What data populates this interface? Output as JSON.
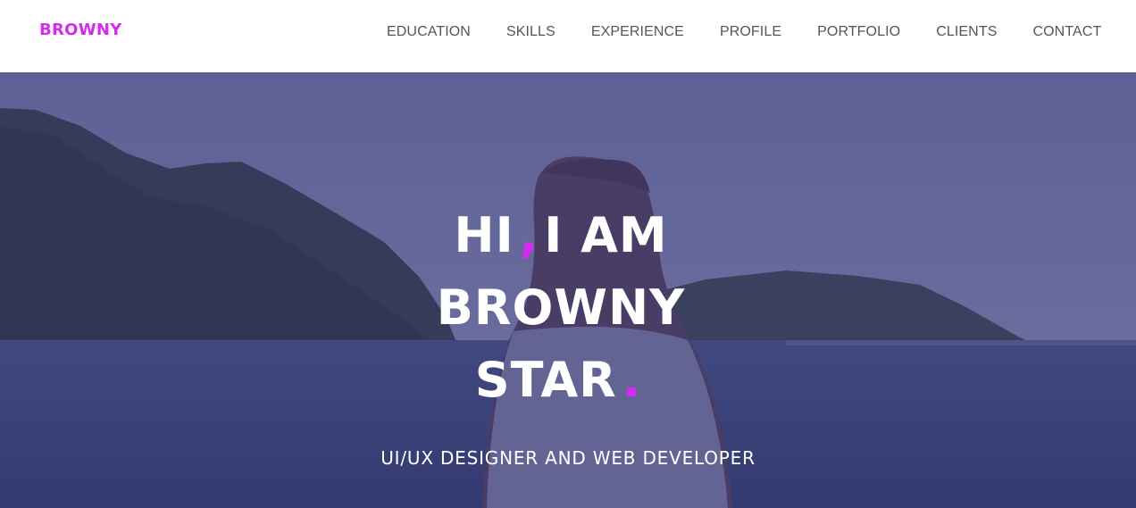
{
  "brand": {
    "label": "BROWNY",
    "color": "#d62af0"
  },
  "nav": {
    "items": [
      {
        "label": "EDUCATION"
      },
      {
        "label": "SKILLS"
      },
      {
        "label": "EXPERIENCE"
      },
      {
        "label": "PROFILE"
      },
      {
        "label": "PORTFOLIO"
      },
      {
        "label": "CLIENTS"
      },
      {
        "label": "CONTACT"
      }
    ]
  },
  "hero": {
    "line1_a": "HI",
    "line1_comma": ",",
    "line1_b": "I AM",
    "line2": "BROWNY",
    "line3": "STAR",
    "line3_dot": ".",
    "subtitle": "UI/UX DESIGNER AND WEB DEVELOPER",
    "accent_color": "#d62af0",
    "overlay_color": "#383280"
  }
}
